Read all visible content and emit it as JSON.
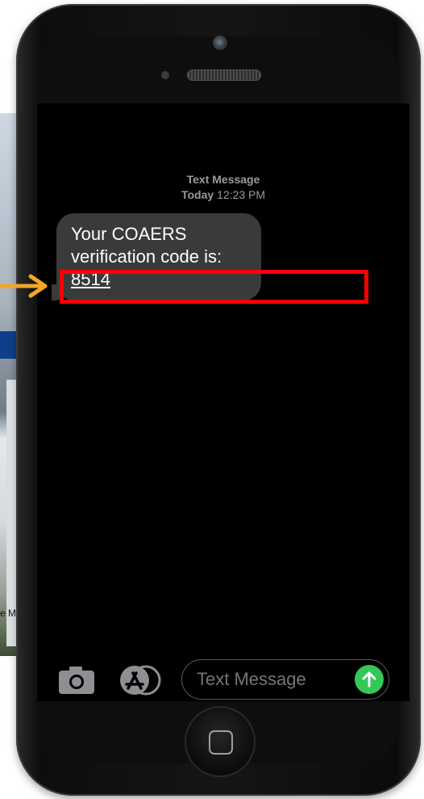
{
  "background": {
    "caption_fragment": "e M"
  },
  "messages": {
    "header_title": "Text Message",
    "header_day": "Today",
    "header_time": "12:23 PM",
    "bubble": {
      "line1": "Your COAERS",
      "line2": "verification code is:",
      "code": "8514"
    }
  },
  "input_bar": {
    "placeholder": "Text Message"
  },
  "colors": {
    "highlight": "#ff0000",
    "arrow": "#f5a623",
    "send": "#34c759",
    "bubble": "#3a3a3c"
  },
  "icons": [
    "camera-icon",
    "app-store-icon",
    "send-arrow-icon",
    "home-icon"
  ]
}
